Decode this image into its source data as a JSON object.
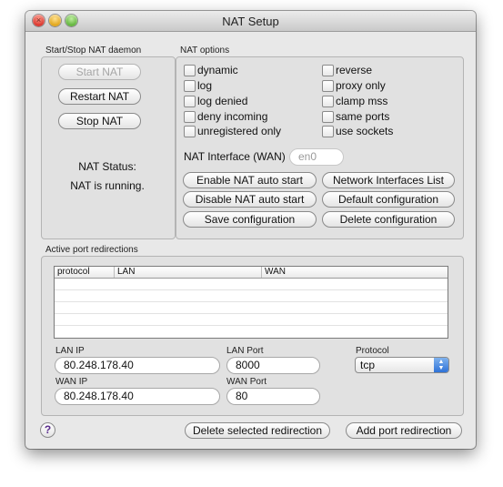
{
  "window": {
    "title": "NAT Setup"
  },
  "daemon": {
    "group_label": "Start/Stop NAT daemon",
    "start_label": "Start NAT",
    "restart_label": "Restart NAT",
    "stop_label": "Stop NAT",
    "status_heading": "NAT Status:",
    "status_text": "NAT is running."
  },
  "options": {
    "group_label": "NAT options",
    "checkboxes_left": [
      {
        "label": "dynamic",
        "checked": false
      },
      {
        "label": "log",
        "checked": false
      },
      {
        "label": "log denied",
        "checked": false
      },
      {
        "label": "deny incoming",
        "checked": false
      },
      {
        "label": "unregistered only",
        "checked": false
      }
    ],
    "checkboxes_right": [
      {
        "label": "reverse",
        "checked": false
      },
      {
        "label": "proxy only",
        "checked": false
      },
      {
        "label": "clamp mss",
        "checked": false
      },
      {
        "label": "same ports",
        "checked": false
      },
      {
        "label": "use sockets",
        "checked": false
      }
    ],
    "interface_label": "NAT Interface (WAN)",
    "interface_value": "en0",
    "buttons": {
      "enable_auto": "Enable NAT auto start",
      "disable_auto": "Disable NAT auto start",
      "save_config": "Save configuration",
      "network_list": "Network Interfaces List",
      "default_config": "Default configuration",
      "delete_config": "Delete configuration"
    }
  },
  "redirections": {
    "group_label": "Active port redirections",
    "columns": [
      "protocol",
      "LAN",
      "WAN"
    ],
    "lan_ip_label": "LAN IP",
    "lan_ip_value": "80.248.178.40",
    "lan_port_label": "LAN Port",
    "lan_port_value": "8000",
    "wan_ip_label": "WAN IP",
    "wan_ip_value": "80.248.178.40",
    "wan_port_label": "WAN Port",
    "wan_port_value": "80",
    "protocol_label": "Protocol",
    "protocol_value": "tcp"
  },
  "footer": {
    "help_glyph": "?",
    "delete_redirection": "Delete selected redirection",
    "add_redirection": "Add port redirection"
  },
  "icons": {
    "help": "help-icon",
    "popup_arrows": "popup-arrows-icon"
  },
  "colors": {
    "window_bg": "#e8e8e8",
    "group_bg": "#e1e1e1",
    "select_accent": "#2e72d8"
  }
}
